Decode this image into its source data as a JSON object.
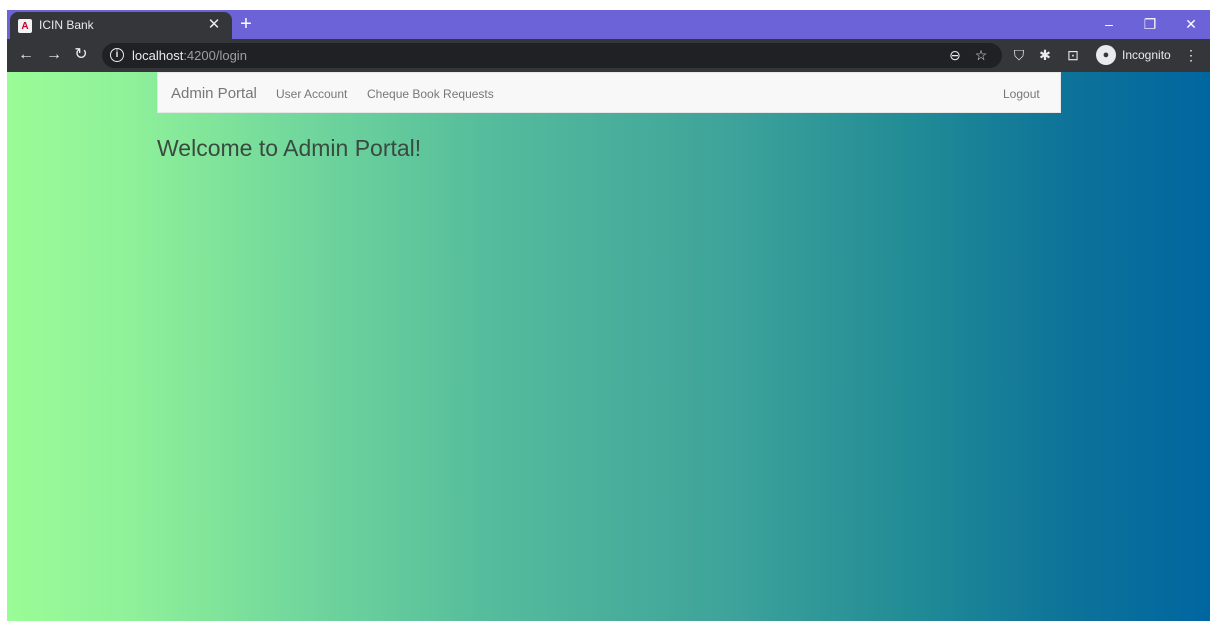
{
  "browser": {
    "tab_title": "ICIN Bank",
    "tab_favicon_letter": "A",
    "url_host": "localhost",
    "url_path": ":4200/login",
    "incognito_label": "Incognito",
    "icons": {
      "tab_close": "close-icon",
      "new_tab": "plus-icon",
      "back": "back-arrow-icon",
      "forward": "forward-arrow-icon",
      "reload": "reload-icon",
      "site_info": "info-icon",
      "zoom": "zoom-out-icon",
      "bookmark": "star-icon",
      "extension_shield": "shield-icon",
      "extensions": "puzzle-icon",
      "cast": "cast-icon",
      "incognito": "incognito-icon",
      "menu": "kebab-menu-icon",
      "minimize": "minimize-icon",
      "restore": "restore-icon",
      "close_window": "close-window-icon"
    },
    "colors": {
      "tabstrip": "#6c63d9",
      "toolbar": "#35363a",
      "omnibox": "#202124"
    }
  },
  "navbar": {
    "brand": "Admin Portal",
    "links": [
      "User Account",
      "Cheque Book Requests"
    ],
    "logout": "Logout"
  },
  "main": {
    "heading": "Welcome to Admin Portal!"
  },
  "page": {
    "gradient_start": "#9afc96",
    "gradient_end": "#0066a0"
  }
}
